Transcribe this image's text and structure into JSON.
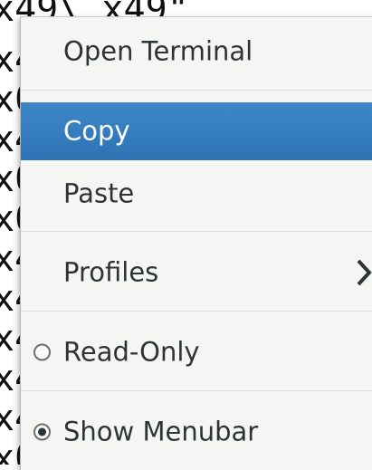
{
  "terminal": {
    "lines": [
      "x49\\ x49\"",
      "x4",
      "x0",
      "x4",
      "x0",
      "x0",
      "x4",
      "x4",
      "x4",
      "x4",
      "x4",
      "x0",
      "x0"
    ]
  },
  "menu": {
    "items": [
      {
        "label": "Open Terminal",
        "state": "normal"
      },
      {
        "label": "Copy",
        "state": "selected"
      },
      {
        "label": "Paste",
        "state": "normal"
      },
      {
        "label": "Profiles",
        "state": "normal",
        "submenu": true,
        "icon": "chevron-right-icon"
      },
      {
        "label": "Read-Only",
        "state": "normal",
        "radio": false,
        "icon": "radio-icon"
      },
      {
        "label": "Show Menubar",
        "state": "normal",
        "radio": true,
        "icon": "radio-icon"
      }
    ],
    "highlight_color": "#3584c9",
    "background_color": "#f5f5f4"
  }
}
